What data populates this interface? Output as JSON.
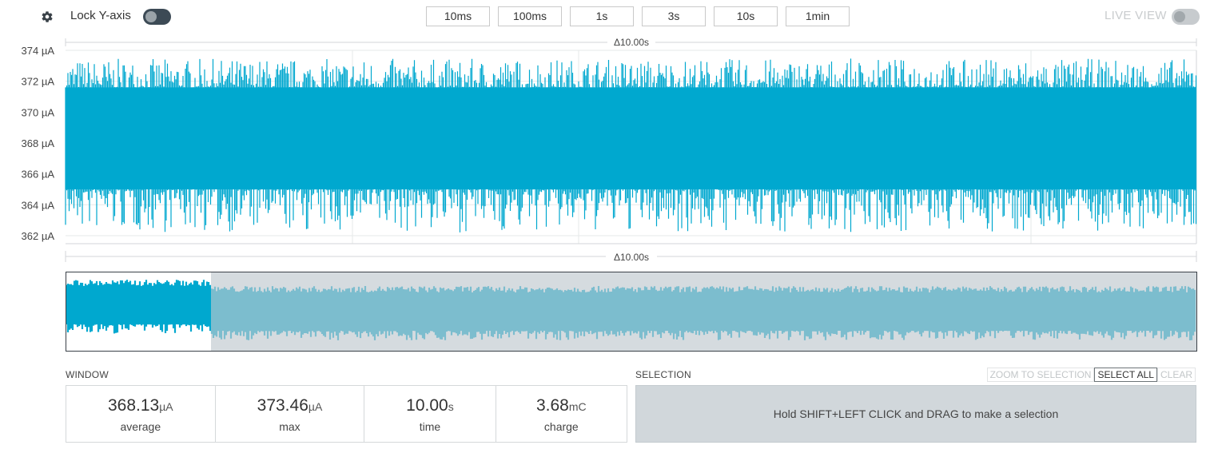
{
  "toolbar": {
    "gear_icon": "gear-icon",
    "lock_y_label": "Lock Y-axis",
    "lock_y_on": false,
    "window_buttons": [
      "10ms",
      "100ms",
      "1s",
      "3s",
      "10s",
      "1min"
    ],
    "live_view_label": "LIVE VIEW",
    "live_view_on": false
  },
  "chart": {
    "top_span_label": "Δ10.00s",
    "bottom_span_label": "Δ10.00s",
    "color": "#00a8cf"
  },
  "chart_data": {
    "type": "line",
    "title": "",
    "xlabel": "",
    "ylabel": "",
    "x_range_s": [
      0,
      10
    ],
    "y_ticks": [
      "374 µA",
      "372 µA",
      "370 µA",
      "368 µA",
      "366 µA",
      "364 µA",
      "362 µA"
    ],
    "y_tick_values": [
      374,
      372,
      370,
      368,
      366,
      364,
      362
    ],
    "ylim": [
      361.5,
      375
    ],
    "series": [
      {
        "band_center": 368.13,
        "band_core": [
          365.0,
          371.6
        ],
        "spike_max": 373.46,
        "spike_min": 362.2
      }
    ],
    "grid": true
  },
  "minimap": {
    "fill_color": "#00a8cf",
    "shaded_color": "#bfc8ce",
    "dimmed_fill_color": "#3d9ab5"
  },
  "window_stats": {
    "label": "WINDOW",
    "items": [
      {
        "value": "368.13",
        "unit": "µA",
        "label": "average"
      },
      {
        "value": "373.46",
        "unit": "µA",
        "label": "max"
      },
      {
        "value": "10.00",
        "unit": "s",
        "label": "time"
      },
      {
        "value": "3.68",
        "unit": "mC",
        "label": "charge"
      }
    ]
  },
  "selection": {
    "label": "SELECTION",
    "zoom_label": "ZOOM TO SELECTION",
    "select_all_label": "SELECT ALL",
    "clear_label": "CLEAR",
    "hint": "Hold SHIFT+LEFT CLICK and DRAG to make a selection"
  }
}
